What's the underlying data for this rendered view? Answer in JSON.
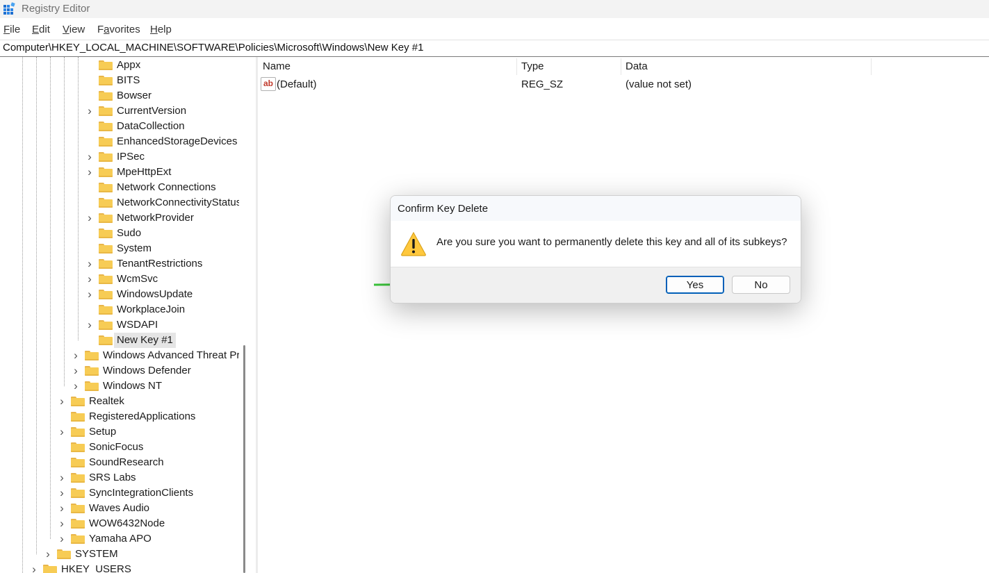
{
  "window": {
    "title": "Registry Editor",
    "app_icon": "registry-editor-icon"
  },
  "menu": [
    {
      "pre": "",
      "acc": "F",
      "post": "ile"
    },
    {
      "pre": "",
      "acc": "E",
      "post": "dit"
    },
    {
      "pre": "",
      "acc": "V",
      "post": "iew"
    },
    {
      "pre": "F",
      "acc": "a",
      "post": "vorites"
    },
    {
      "pre": "",
      "acc": "H",
      "post": "elp"
    }
  ],
  "address": "Computer\\HKEY_LOCAL_MACHINE\\SOFTWARE\\Policies\\Microsoft\\Windows\\New Key #1",
  "tree": [
    {
      "label": "Appx",
      "level": 3,
      "expandable": false
    },
    {
      "label": "BITS",
      "level": 3,
      "expandable": false
    },
    {
      "label": "Bowser",
      "level": 3,
      "expandable": false
    },
    {
      "label": "CurrentVersion",
      "level": 3,
      "expandable": true
    },
    {
      "label": "DataCollection",
      "level": 3,
      "expandable": false
    },
    {
      "label": "EnhancedStorageDevices",
      "level": 3,
      "expandable": false
    },
    {
      "label": "IPSec",
      "level": 3,
      "expandable": true
    },
    {
      "label": "MpeHttpExt",
      "level": 3,
      "expandable": true
    },
    {
      "label": "Network Connections",
      "level": 3,
      "expandable": false
    },
    {
      "label": "NetworkConnectivityStatus",
      "level": 3,
      "expandable": false
    },
    {
      "label": "NetworkProvider",
      "level": 3,
      "expandable": true
    },
    {
      "label": "Sudo",
      "level": 3,
      "expandable": false
    },
    {
      "label": "System",
      "level": 3,
      "expandable": false
    },
    {
      "label": "TenantRestrictions",
      "level": 3,
      "expandable": true
    },
    {
      "label": "WcmSvc",
      "level": 3,
      "expandable": true
    },
    {
      "label": "WindowsUpdate",
      "level": 3,
      "expandable": true
    },
    {
      "label": "WorkplaceJoin",
      "level": 3,
      "expandable": false
    },
    {
      "label": "WSDAPI",
      "level": 3,
      "expandable": true
    },
    {
      "label": "New Key #1",
      "level": 3,
      "expandable": false,
      "selected": true
    },
    {
      "label": "Windows Advanced Threat Pro",
      "level": 2,
      "expandable": true
    },
    {
      "label": "Windows Defender",
      "level": 2,
      "expandable": true
    },
    {
      "label": "Windows NT",
      "level": 2,
      "expandable": true
    },
    {
      "label": "Realtek",
      "level": 1,
      "expandable": true
    },
    {
      "label": "RegisteredApplications",
      "level": 1,
      "expandable": false
    },
    {
      "label": "Setup",
      "level": 1,
      "expandable": true
    },
    {
      "label": "SonicFocus",
      "level": 1,
      "expandable": false
    },
    {
      "label": "SoundResearch",
      "level": 1,
      "expandable": false
    },
    {
      "label": "SRS Labs",
      "level": 1,
      "expandable": true
    },
    {
      "label": "SyncIntegrationClients",
      "level": 1,
      "expandable": true
    },
    {
      "label": "Waves Audio",
      "level": 1,
      "expandable": true
    },
    {
      "label": "WOW6432Node",
      "level": 1,
      "expandable": true
    },
    {
      "label": "Yamaha APO",
      "level": 1,
      "expandable": true
    },
    {
      "label": "SYSTEM",
      "level": 0,
      "expandable": true
    },
    {
      "label": "HKEY_USERS",
      "level": -1,
      "expandable": true
    }
  ],
  "columns": {
    "name": "Name",
    "type": "Type",
    "data": "Data"
  },
  "values": [
    {
      "name": "(Default)",
      "type": "REG_SZ",
      "data": "(value not set)",
      "icon": "string-value-icon"
    }
  ],
  "dialog": {
    "title": "Confirm Key Delete",
    "message": "Are you sure you want to permanently delete this key and all of its subkeys?",
    "icon": "warning-icon",
    "yes_label": "Yes",
    "no_label": "No"
  },
  "annotation": {
    "type": "arrow",
    "color": "#3cc83c",
    "points_to": "Yes"
  },
  "colors": {
    "folder": "#f7cc55",
    "accent": "#005fb8",
    "selection": "#e5e5e5"
  }
}
